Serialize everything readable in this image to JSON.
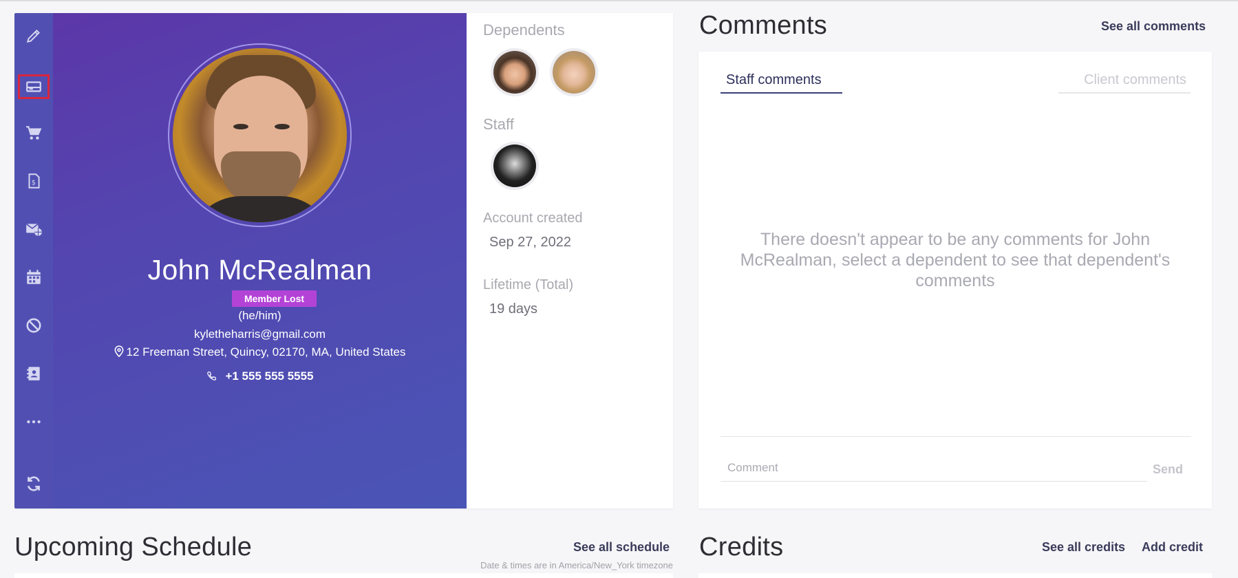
{
  "profile": {
    "name": "John McRealman",
    "status_badge": "Member Lost",
    "pronouns": "(he/him)",
    "email": "kyletheharris@gmail.com",
    "address": "12 Freeman Street, Quincy, 02170, MA, United States",
    "phone": "+1 555 555 5555"
  },
  "sidebar": {
    "items": [
      {
        "name": "edit",
        "icon": "pencil-icon"
      },
      {
        "name": "payment",
        "icon": "credit-card-icon",
        "active": true
      },
      {
        "name": "shop",
        "icon": "cart-icon"
      },
      {
        "name": "invoices",
        "icon": "invoice-icon"
      },
      {
        "name": "messages",
        "icon": "envelope-globe-icon"
      },
      {
        "name": "calendar",
        "icon": "calendar-icon"
      },
      {
        "name": "block",
        "icon": "ban-icon"
      },
      {
        "name": "contacts",
        "icon": "address-book-icon"
      },
      {
        "name": "more",
        "icon": "ellipsis-icon"
      },
      {
        "name": "refresh",
        "icon": "refresh-icon"
      }
    ]
  },
  "details": {
    "dependents_label": "Dependents",
    "staff_label": "Staff",
    "account_created_label": "Account created",
    "account_created_value": "Sep 27, 2022",
    "lifetime_label": "Lifetime (Total)",
    "lifetime_value": "19 days"
  },
  "comments": {
    "title": "Comments",
    "see_all": "See all comments",
    "tab_staff": "Staff comments",
    "tab_client": "Client comments",
    "empty_message": "There doesn't appear to be any comments for John McRealman, select a dependent to see that dependent's comments",
    "input_placeholder": "Comment",
    "send_label": "Send"
  },
  "schedule": {
    "title": "Upcoming Schedule",
    "see_all": "See all schedule",
    "timezone_note": "Date & times are in America/New_York timezone"
  },
  "credits": {
    "title": "Credits",
    "see_all": "See all credits",
    "add": "Add credit"
  },
  "colors": {
    "sidebar": "#5150b2",
    "badge": "#b343d6",
    "active_outline": "#d9263e",
    "link": "#3a3b5a"
  }
}
